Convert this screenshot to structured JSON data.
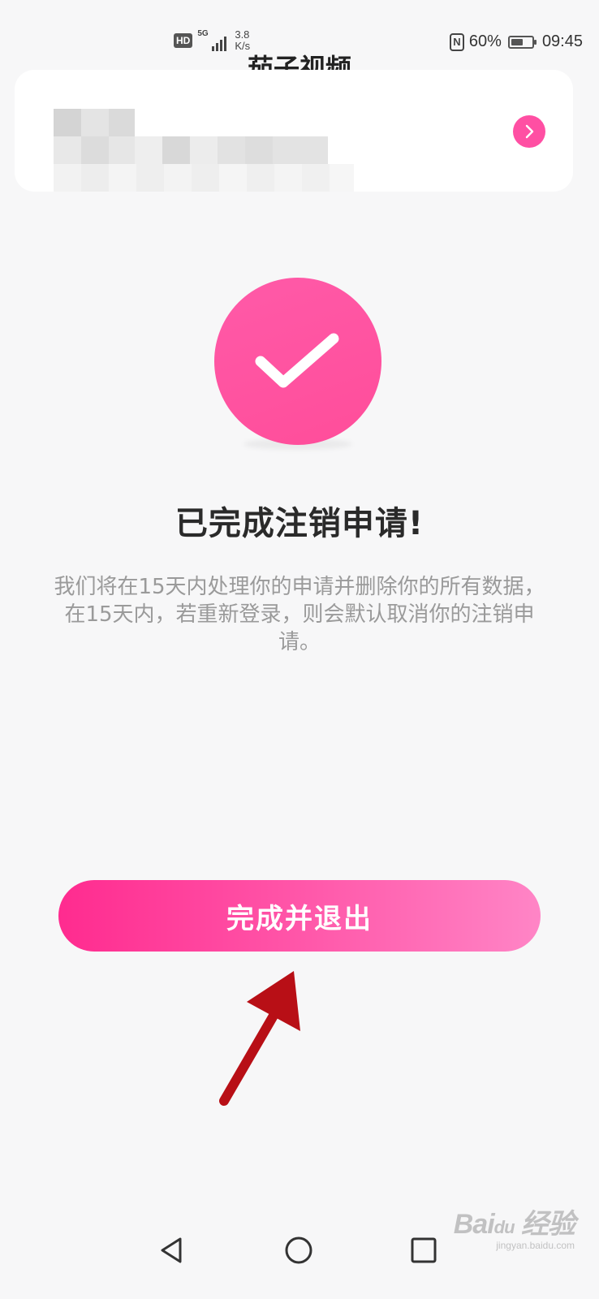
{
  "status_bar": {
    "hd_badge": "HD",
    "network_gen": "5G",
    "net_speed_value": "3.8",
    "net_speed_unit": "K/s",
    "nfc_label": "N",
    "battery_percent": "60%",
    "battery_level": 0.6,
    "time": "09:45"
  },
  "page": {
    "title": "茄子视频"
  },
  "success": {
    "headline": "已完成注销申请!",
    "description": "我们将在15天内处理你的申请并删除你的所有数据，在15天内，若重新登录，则会默认取消你的注销申请。"
  },
  "actions": {
    "finish_label": "完成并退出"
  },
  "watermark": {
    "brand": "Bai",
    "brand_suffix": "经验",
    "url": "jingyan.baidu.com"
  },
  "colors": {
    "accent": "#ff4fa3",
    "button_start": "#ff2b8f",
    "button_end": "#ff85c6",
    "annotation_arrow": "#b80f16",
    "description_text": "#9a9a9a"
  },
  "icons": {
    "check": "check-icon",
    "card_arrow": "chevron-right-icon",
    "nav_back": "triangle-back-icon",
    "nav_home": "circle-home-icon",
    "nav_recent": "square-recent-icon"
  }
}
